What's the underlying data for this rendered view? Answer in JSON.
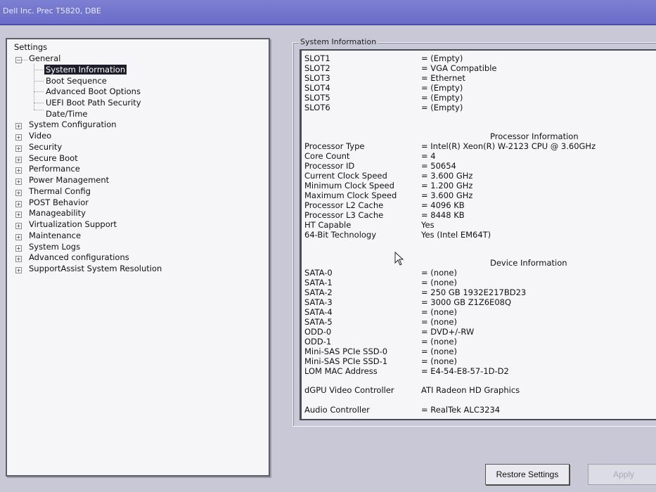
{
  "window": {
    "title": "Dell Inc. Prec T5820, DBE"
  },
  "settings_tree": {
    "root": "Settings",
    "general": {
      "label": "General",
      "children": [
        "System Information",
        "Boot Sequence",
        "Advanced Boot Options",
        "UEFI Boot Path Security",
        "Date/Time"
      ]
    },
    "sections": [
      "System Configuration",
      "Video",
      "Security",
      "Secure Boot",
      "Performance",
      "Power Management",
      "Thermal Config",
      "POST Behavior",
      "Manageability",
      "Virtualization Support",
      "Maintenance",
      "System Logs",
      "Advanced configurations",
      "SupportAssist System Resolution"
    ]
  },
  "panel": {
    "title": "System Information",
    "slots": [
      {
        "label": "SLOT1",
        "value": "= (Empty)"
      },
      {
        "label": "SLOT2",
        "value": "= VGA Compatible"
      },
      {
        "label": "SLOT3",
        "value": "= Ethernet"
      },
      {
        "label": "SLOT4",
        "value": "= (Empty)"
      },
      {
        "label": "SLOT5",
        "value": "= (Empty)"
      },
      {
        "label": "SLOT6",
        "value": "= (Empty)"
      }
    ],
    "processor_heading": "Processor Information",
    "processor": [
      {
        "label": "Processor Type",
        "value": "= Intel(R) Xeon(R) W-2123 CPU @ 3.60GHz"
      },
      {
        "label": "Core Count",
        "value": "= 4"
      },
      {
        "label": "Processor ID",
        "value": "= 50654"
      },
      {
        "label": "Current Clock Speed",
        "value": "= 3.600 GHz"
      },
      {
        "label": "Minimum Clock Speed",
        "value": "= 1.200 GHz"
      },
      {
        "label": "Maximum Clock Speed",
        "value": "= 3.600 GHz"
      },
      {
        "label": "Processor L2 Cache",
        "value": "= 4096 KB"
      },
      {
        "label": "Processor L3 Cache",
        "value": "= 8448 KB"
      },
      {
        "label": "HT Capable",
        "value": "Yes"
      },
      {
        "label": "64-Bit Technology",
        "value": "Yes (Intel EM64T)"
      }
    ],
    "device_heading": "Device Information",
    "devices": [
      {
        "label": "SATA-0",
        "value": "= (none)"
      },
      {
        "label": "SATA-1",
        "value": "= (none)"
      },
      {
        "label": "SATA-2",
        "value": "= 250 GB 1932E217BD23"
      },
      {
        "label": "SATA-3",
        "value": "= 3000 GB Z1Z6E08Q"
      },
      {
        "label": "SATA-4",
        "value": "= (none)"
      },
      {
        "label": "SATA-5",
        "value": "= (none)"
      },
      {
        "label": "ODD-0",
        "value": "= DVD+/-RW"
      },
      {
        "label": "ODD-1",
        "value": "= (none)"
      },
      {
        "label": "Mini-SAS PCIe SSD-0",
        "value": "= (none)"
      },
      {
        "label": "Mini-SAS PCIe SSD-1",
        "value": "= (none)"
      },
      {
        "label": "LOM MAC Address",
        "value": "= E4-54-E8-57-1D-D2"
      }
    ],
    "gpu": {
      "label": "dGPU Video Controller",
      "value": "ATI Radeon HD Graphics"
    },
    "audio": {
      "label": "Audio Controller",
      "value": "= RealTek ALC3234"
    }
  },
  "buttons": {
    "restore": "Restore Settings",
    "apply": "Apply"
  }
}
